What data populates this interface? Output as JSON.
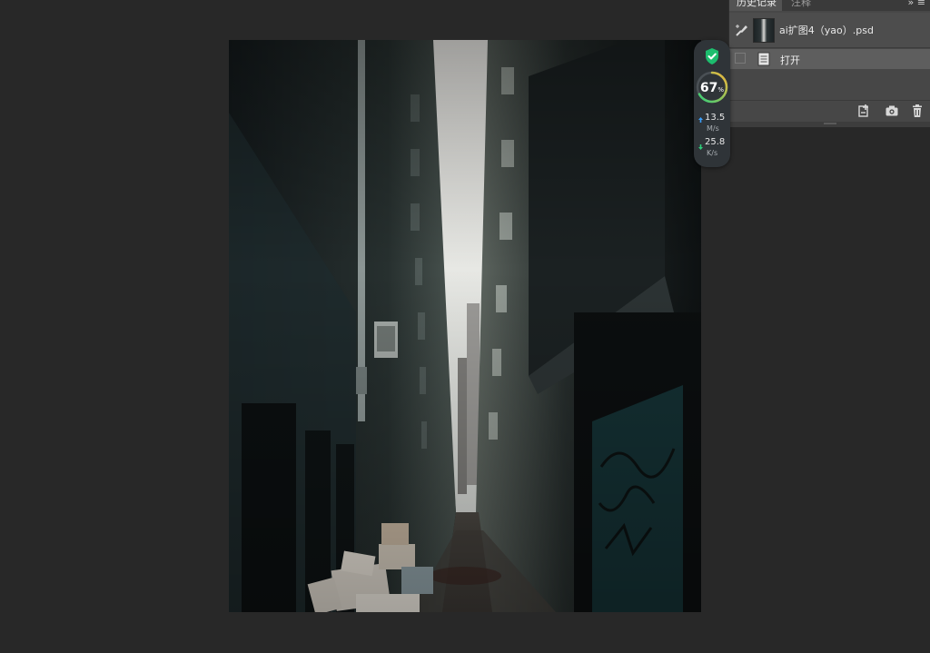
{
  "history_panel": {
    "tabs": [
      {
        "label": "历史记录",
        "active": true
      },
      {
        "label": "注释",
        "active": false
      }
    ],
    "menu_glyph": "»  ≡",
    "snapshot_name": "ai扩图4（yao）.psd",
    "items": [
      {
        "label": "打开"
      }
    ],
    "footer_icons": [
      "new-document-from-state-icon",
      "camera-icon",
      "trash-icon"
    ]
  },
  "net_widget": {
    "percent": "67",
    "percent_unit": "%",
    "upload_value": "13.5",
    "upload_unit": "M/s",
    "download_value": "25.8",
    "download_unit": "K/s",
    "colors": {
      "shield": "#1dbd6e",
      "ring_start": "#2ecf7a",
      "ring_end": "#f5b73a",
      "up": "#3aa0ff",
      "down": "#2ecf7a"
    }
  },
  "colors": {
    "workspace": "#282828",
    "panel": "#474747",
    "selected_row": "#5e5e5e"
  }
}
